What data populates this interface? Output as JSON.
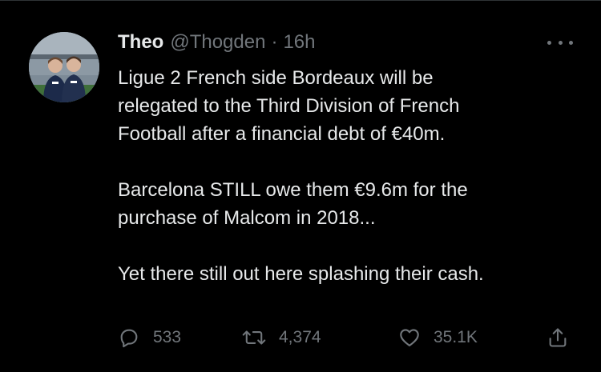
{
  "tweet": {
    "author_name": "Theo",
    "author_handle": "@Thogden",
    "separator": "·",
    "timestamp": "16h",
    "avatar_icon": "profile-photo",
    "more_icon": "more-horizontal-icon",
    "lines": [
      "Ligue 2 French side Bordeaux will be",
      "relegated to the Third Division of French",
      "Football after a financial debt of €40m.",
      "",
      "Barcelona STILL owe them €9.6m for the",
      "purchase of Malcom in 2018...",
      "",
      "Yet there still out here splashing their cash."
    ],
    "actions": {
      "replies": "533",
      "retweets": "4,374",
      "likes": "35.1K"
    }
  },
  "colors": {
    "background": "#000000",
    "text_primary": "#e7e9ea",
    "text_secondary": "#71767b",
    "divider": "#2f3336"
  }
}
